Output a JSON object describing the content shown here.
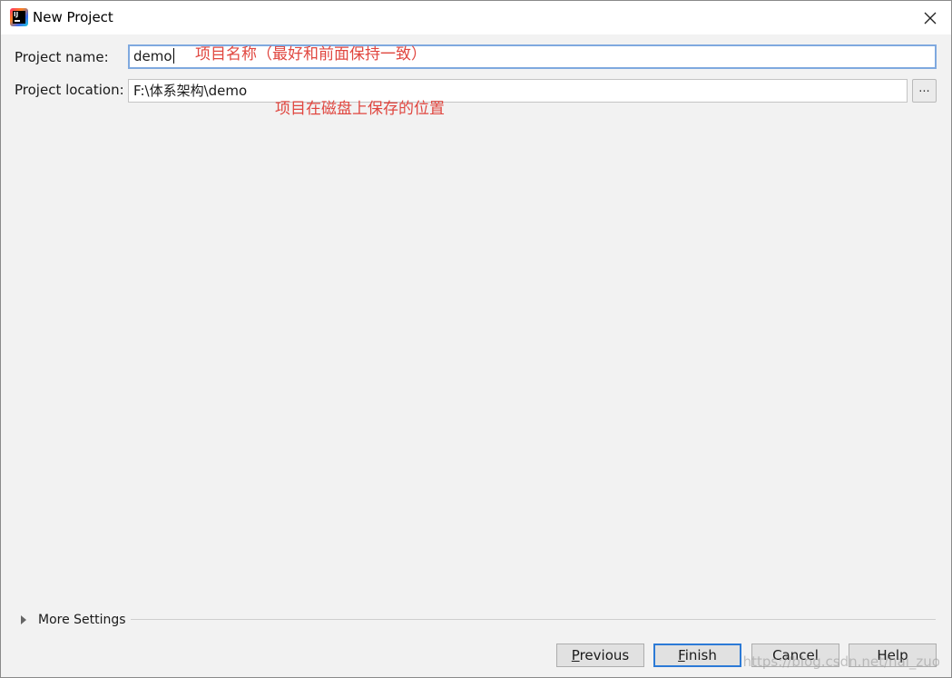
{
  "window": {
    "title": "New Project",
    "close_icon": "close-icon"
  },
  "form": {
    "project_name_label": "Project name:",
    "project_name_value": "demo",
    "project_location_label": "Project location:",
    "project_location_value": "F:\\体系架构\\demo",
    "browse_label": "..."
  },
  "annotations": {
    "name_note": "项目名称（最好和前面保持一致）",
    "location_note": "项目在磁盘上保存的位置",
    "color": "#e0463f"
  },
  "more_settings": {
    "label": "More Settings",
    "icon": "expand-triangle-icon"
  },
  "buttons": {
    "previous": {
      "mnemonic": "P",
      "rest": "revious"
    },
    "finish": {
      "mnemonic": "F",
      "rest": "inish"
    },
    "cancel": {
      "label": "Cancel"
    },
    "help": {
      "label": "Help"
    }
  },
  "watermark": "https://blog.csdn.net/hai_zuo"
}
